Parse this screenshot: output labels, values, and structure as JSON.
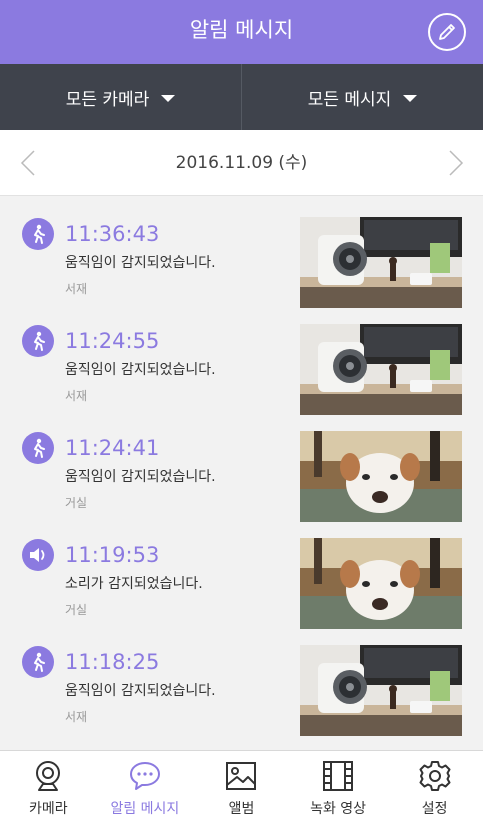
{
  "header": {
    "title": "알림 메시지",
    "edit_icon": "pencil-icon"
  },
  "filters": {
    "camera": "모든 카메라",
    "message": "모든 메시지"
  },
  "date_nav": {
    "date": "2016.11.09 (수)"
  },
  "notifications": [
    {
      "type": "motion",
      "icon": "walking-person-icon",
      "time": "11:36:43",
      "message": "움직임이 감지되었습니다.",
      "location": "서재",
      "thumbnail": "speaker-desk-photo"
    },
    {
      "type": "motion",
      "icon": "walking-person-icon",
      "time": "11:24:55",
      "message": "움직임이 감지되었습니다.",
      "location": "서재",
      "thumbnail": "speaker-desk-photo"
    },
    {
      "type": "motion",
      "icon": "walking-person-icon",
      "time": "11:24:41",
      "message": "움직임이 감지되었습니다.",
      "location": "거실",
      "thumbnail": "dog-photo"
    },
    {
      "type": "sound",
      "icon": "speaker-icon",
      "time": "11:19:53",
      "message": "소리가 감지되었습니다.",
      "location": "거실",
      "thumbnail": "dog-photo"
    },
    {
      "type": "motion",
      "icon": "walking-person-icon",
      "time": "11:18:25",
      "message": "움직임이 감지되었습니다.",
      "location": "서재",
      "thumbnail": "speaker-desk-photo"
    }
  ],
  "tabs": [
    {
      "label": "카메라",
      "icon": "webcam-icon",
      "active": false
    },
    {
      "label": "알림 메시지",
      "icon": "chat-bubble-icon",
      "active": true
    },
    {
      "label": "앨범",
      "icon": "image-icon",
      "active": false
    },
    {
      "label": "녹화 영상",
      "icon": "film-icon",
      "active": false
    },
    {
      "label": "설정",
      "icon": "gear-icon",
      "active": false
    }
  ],
  "colors": {
    "accent": "#8b7ae0",
    "filter_bar": "#3f434c",
    "background": "#f2f2f2"
  }
}
